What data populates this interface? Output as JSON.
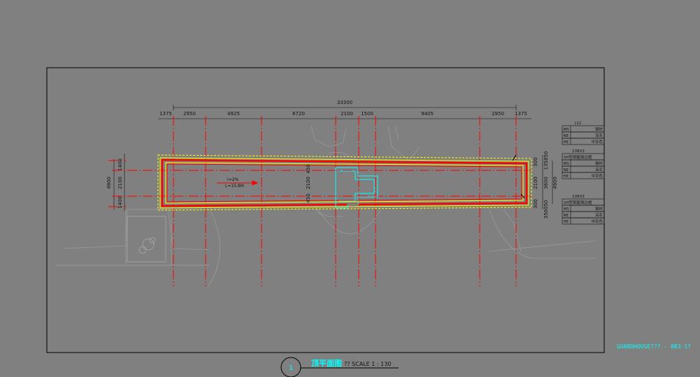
{
  "overall_dimension": "33300",
  "top_dimensions": [
    "1375",
    "2950",
    "4925",
    "6720",
    "2100",
    "1500",
    "9405",
    "2950",
    "1375"
  ],
  "left_dimensions": {
    "overall": "4900",
    "segments": [
      "1400",
      "2100",
      "1400"
    ]
  },
  "center_dimensions": [
    "450",
    "2100",
    "450"
  ],
  "right_dimensions": {
    "overall_a": "3600",
    "overall_b": "4900",
    "segments": [
      "300",
      "2100",
      "300"
    ],
    "top_small": "135850",
    "bottom_small": "350050"
  },
  "slope_note": {
    "slope": "i=2%",
    "length": "L=15.8M"
  },
  "legend_tables": [
    {
      "header": "[12",
      "rows": [
        {
          "code": "MS",
          "value": "钢材"
        },
        {
          "code": "NE",
          "value": "深灰"
        },
        {
          "code": "HE",
          "value": "中灰色"
        }
      ]
    },
    {
      "header": "108X3",
      "subheader": "SH型钢屋面边框",
      "rows": [
        {
          "code": "MS",
          "value": "钢材"
        },
        {
          "code": "NE",
          "value": "深灰"
        },
        {
          "code": "HE",
          "value": "中灰色"
        }
      ]
    },
    {
      "header": "108X3",
      "subheader": "SH型钢屋面边框",
      "rows": [
        {
          "code": "MS",
          "value": "钢材"
        },
        {
          "code": "NE",
          "value": "深灰"
        },
        {
          "code": "HE",
          "value": "中灰色"
        }
      ]
    }
  ],
  "sheet_reference": "GUARDHOUSE??? - 083-1?",
  "drawing_title": {
    "number": "1",
    "name": "顶平面图",
    "scale": "?? SCALE 1 : 130"
  },
  "colors": {
    "background": "#808080",
    "frame": "#000000",
    "axis": "#ff0000",
    "roof_outline": "#ff0000",
    "roof_edge": "#ffff00",
    "detail": "#00ffff",
    "dim_text": "#111111"
  }
}
